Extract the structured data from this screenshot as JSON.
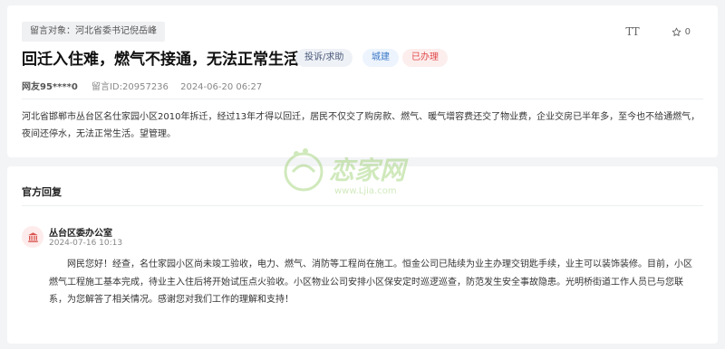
{
  "message": {
    "target_label": "留言对象：",
    "target_name": "河北省委书记倪岳峰",
    "title": "回迁入住难，燃气不接通，无法正常生活",
    "tags": {
      "type": "投诉/求助",
      "category": "城建",
      "status": "已办理"
    },
    "font_size_icon": "TT",
    "favorite_count": "0",
    "user": "网友95****0",
    "message_id": "留言ID:20957236",
    "datetime": "2024-06-20 06:27",
    "content": "河北省邯郸市丛台区名仕家园小区2010年拆迁，经过13年才得以回迁，居民不仅交了购房款、燃气、暖气增容费还交了物业费，企业交房已半年多，至今也不给通燃气，夜间还停水，无法正常生活。望管理。"
  },
  "reply": {
    "heading": "官方回复",
    "org_name": "丛台区委办公室",
    "date": "2024-07-16 10:13",
    "text": "网民您好！经查，名仕家园小区尚未竣工验收，电力、燃气、消防等工程尚在施工。恒金公司已陆续为业主办理交钥匙手续，业主可以装饰装修。目前，小区燃气工程施工基本完成，待业主入住后将开始试压点火验收。小区物业公司安排小区保安定时巡逻巡查，防范发生安全事故隐患。光明桥街道工作人员已与您联系，为您解答了相关情况。感谢您对我们工作的理解和支持！"
  },
  "watermark": {
    "text": "恋家网",
    "url": "www.Ljia.com"
  },
  "colors": {
    "status_red": "#e04848",
    "category_blue": "#3c78c8",
    "watermark_green": "#7cc242"
  }
}
